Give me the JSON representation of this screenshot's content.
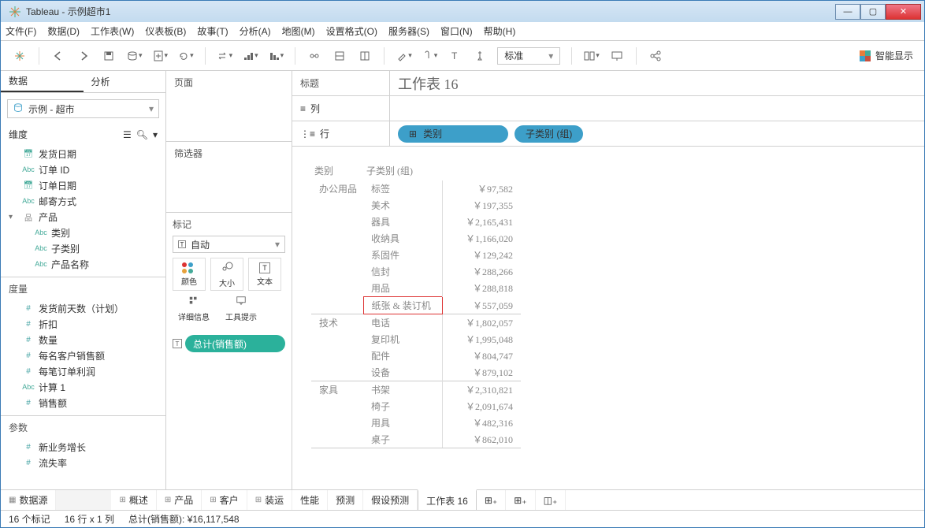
{
  "title": "Tableau - 示例超市1",
  "menu": [
    "文件(F)",
    "数据(D)",
    "工作表(W)",
    "仪表板(B)",
    "故事(T)",
    "分析(A)",
    "地图(M)",
    "设置格式(O)",
    "服务器(S)",
    "窗口(N)",
    "帮助(H)"
  ],
  "toolbar": {
    "standard": "标准",
    "smart": "智能显示"
  },
  "left": {
    "tabs": {
      "data": "数据",
      "analysis": "分析"
    },
    "datasource": "示例 - 超市",
    "dims_hdr": "维度",
    "dims": [
      {
        "icon": "date",
        "label": "发货日期"
      },
      {
        "icon": "abc",
        "label": "订单 ID"
      },
      {
        "icon": "date",
        "label": "订单日期"
      },
      {
        "icon": "abc",
        "label": "邮寄方式"
      },
      {
        "icon": "hier",
        "label": "产品",
        "expanded": true
      },
      {
        "icon": "abc",
        "label": "类别",
        "indent": true
      },
      {
        "icon": "abc",
        "label": "子类别",
        "indent": true
      },
      {
        "icon": "abc",
        "label": "产品名称",
        "indent": true
      }
    ],
    "meas_hdr": "度量",
    "meas": [
      {
        "icon": "hash",
        "label": "发货前天数（计划）"
      },
      {
        "icon": "hash",
        "label": "折扣"
      },
      {
        "icon": "hash",
        "label": "数量"
      },
      {
        "icon": "hash",
        "label": "每名客户销售额"
      },
      {
        "icon": "hash",
        "label": "每笔订单利润"
      },
      {
        "icon": "abc",
        "label": "计算 1"
      },
      {
        "icon": "hash",
        "label": "销售额"
      }
    ],
    "param_hdr": "参数",
    "params": [
      {
        "icon": "hash",
        "label": "新业务增长"
      },
      {
        "icon": "hash",
        "label": "流失率"
      }
    ]
  },
  "mid": {
    "pages": "页面",
    "filters": "筛选器",
    "marks": "标记",
    "marktype": "自动",
    "cells": {
      "color": "颜色",
      "size": "大小",
      "text": "文本",
      "detail": "详细信息",
      "tooltip": "工具提示"
    },
    "pill": "总计(销售额)"
  },
  "shelves": {
    "title_lab": "标题",
    "title_val": "工作表 16",
    "cols_lab": "列",
    "rows_lab": "行",
    "row_pills": [
      "类别",
      "子类别 (组)"
    ]
  },
  "chart_data": {
    "type": "table",
    "headers": [
      "类别",
      "子类别 (组)"
    ],
    "rows": [
      {
        "cat": "办公用品",
        "sub": "标签",
        "val": "￥97,582"
      },
      {
        "cat": "",
        "sub": "美术",
        "val": "￥197,355"
      },
      {
        "cat": "",
        "sub": "器具",
        "val": "￥2,165,431"
      },
      {
        "cat": "",
        "sub": "收纳具",
        "val": "￥1,166,020"
      },
      {
        "cat": "",
        "sub": "系固件",
        "val": "￥129,242"
      },
      {
        "cat": "",
        "sub": "信封",
        "val": "￥288,266"
      },
      {
        "cat": "",
        "sub": "用品",
        "val": "￥288,818"
      },
      {
        "cat": "",
        "sub": "纸张 & 装订机",
        "val": "￥557,059",
        "hl": true
      },
      {
        "cat": "技术",
        "sub": "电话",
        "val": "￥1,802,057",
        "sect": true
      },
      {
        "cat": "",
        "sub": "复印机",
        "val": "￥1,995,048"
      },
      {
        "cat": "",
        "sub": "配件",
        "val": "￥804,747"
      },
      {
        "cat": "",
        "sub": "设备",
        "val": "￥879,102"
      },
      {
        "cat": "家具",
        "sub": "书架",
        "val": "￥2,310,821",
        "sect": true
      },
      {
        "cat": "",
        "sub": "椅子",
        "val": "￥2,091,674"
      },
      {
        "cat": "",
        "sub": "用具",
        "val": "￥482,316"
      },
      {
        "cat": "",
        "sub": "桌子",
        "val": "￥862,010",
        "last": true
      }
    ]
  },
  "bottom": {
    "datasource": "数据源",
    "tabs": [
      {
        "kind": "sheet",
        "label": "概述"
      },
      {
        "kind": "sheet",
        "label": "产品"
      },
      {
        "kind": "sheet",
        "label": "客户"
      },
      {
        "kind": "sheet",
        "label": "装运"
      },
      {
        "kind": "plain",
        "label": "性能"
      },
      {
        "kind": "plain",
        "label": "预测"
      },
      {
        "kind": "plain",
        "label": "假设预测"
      },
      {
        "kind": "plain",
        "label": "工作表 16",
        "active": true
      }
    ]
  },
  "status": {
    "marks": "16 个标记",
    "rows": "16 行 x 1 列",
    "sum": "总计(销售额): ¥16,117,548"
  }
}
